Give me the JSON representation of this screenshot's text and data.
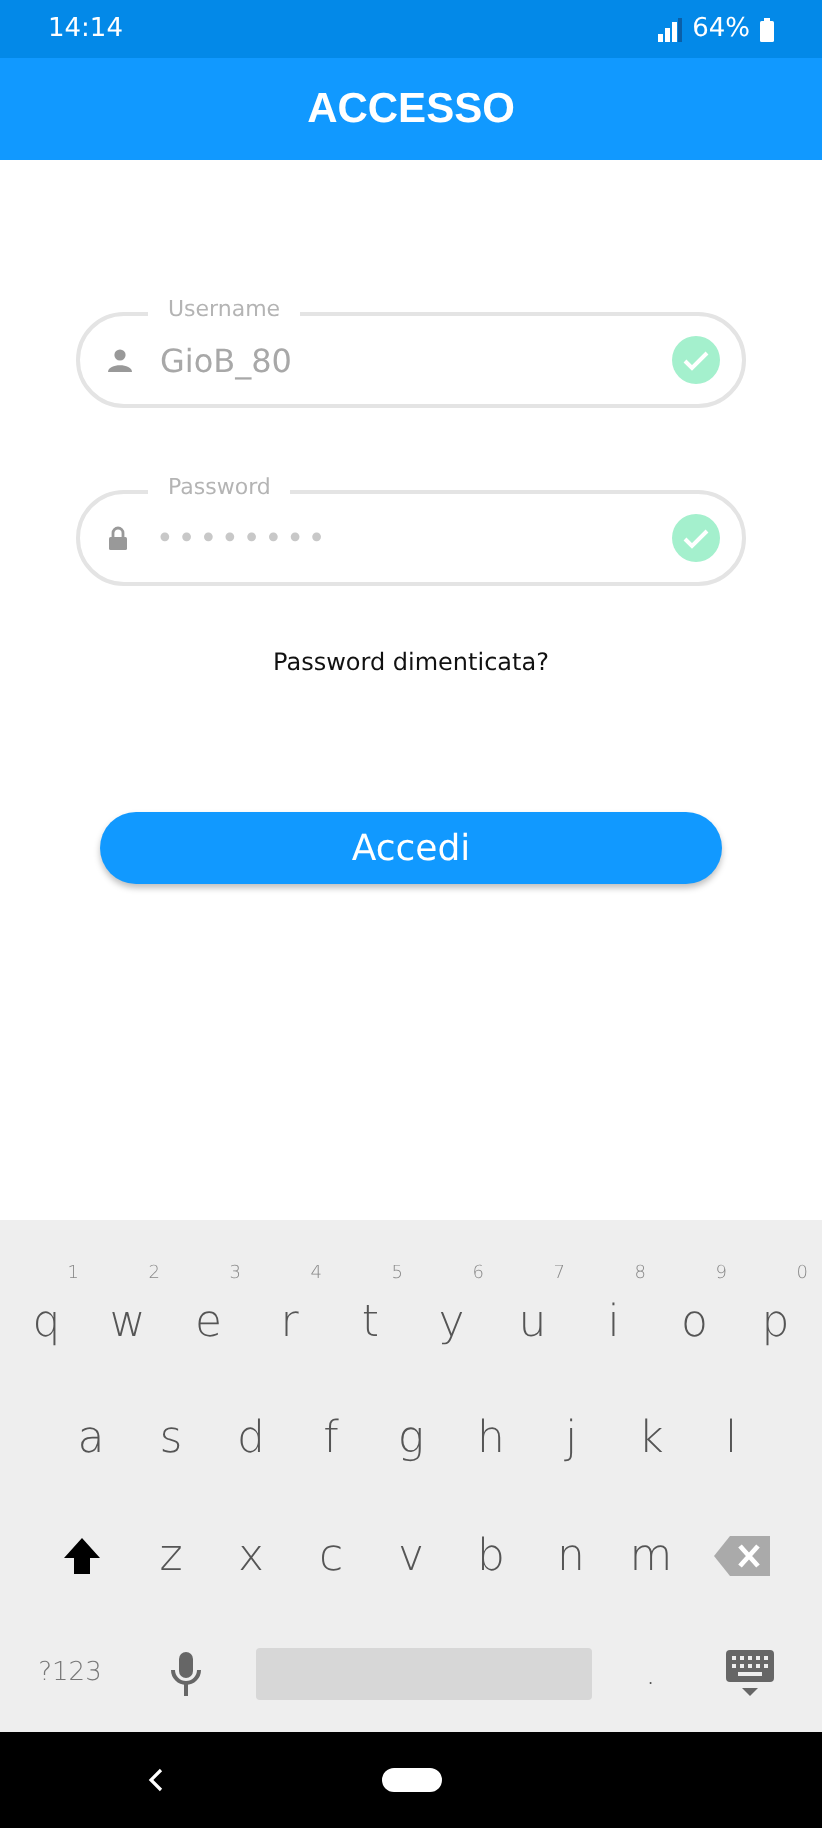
{
  "status_bar": {
    "time": "14:14",
    "battery": "64%"
  },
  "header": {
    "title": "ACCESSO"
  },
  "fields": [
    {
      "kind": "text",
      "label": "Username",
      "value": "GioB_80",
      "valid": true
    },
    {
      "kind": "password",
      "label": "Password",
      "value": "••••••••",
      "valid": true
    }
  ],
  "forgot_link": "Password dimenticata?",
  "login_button": "Accedi",
  "keyboard": {
    "rows": [
      [
        {
          "key": "q",
          "hint": "1"
        },
        {
          "key": "w",
          "hint": "2"
        },
        {
          "key": "e",
          "hint": "3"
        },
        {
          "key": "r",
          "hint": "4"
        },
        {
          "key": "t",
          "hint": "5"
        },
        {
          "key": "y",
          "hint": "6"
        },
        {
          "key": "u",
          "hint": "7"
        },
        {
          "key": "i",
          "hint": "8"
        },
        {
          "key": "o",
          "hint": "9"
        },
        {
          "key": "p",
          "hint": "0"
        }
      ],
      [
        {
          "key": "a"
        },
        {
          "key": "s"
        },
        {
          "key": "d"
        },
        {
          "key": "f"
        },
        {
          "key": "g"
        },
        {
          "key": "h"
        },
        {
          "key": "j"
        },
        {
          "key": "k"
        },
        {
          "key": "l"
        }
      ],
      [
        {
          "kind": "shift"
        },
        {
          "key": "z"
        },
        {
          "key": "x"
        },
        {
          "key": "c"
        },
        {
          "key": "v"
        },
        {
          "key": "b"
        },
        {
          "key": "n"
        },
        {
          "key": "m"
        },
        {
          "kind": "backspace"
        }
      ]
    ],
    "symbols_key": "?123",
    "period_key": "."
  }
}
